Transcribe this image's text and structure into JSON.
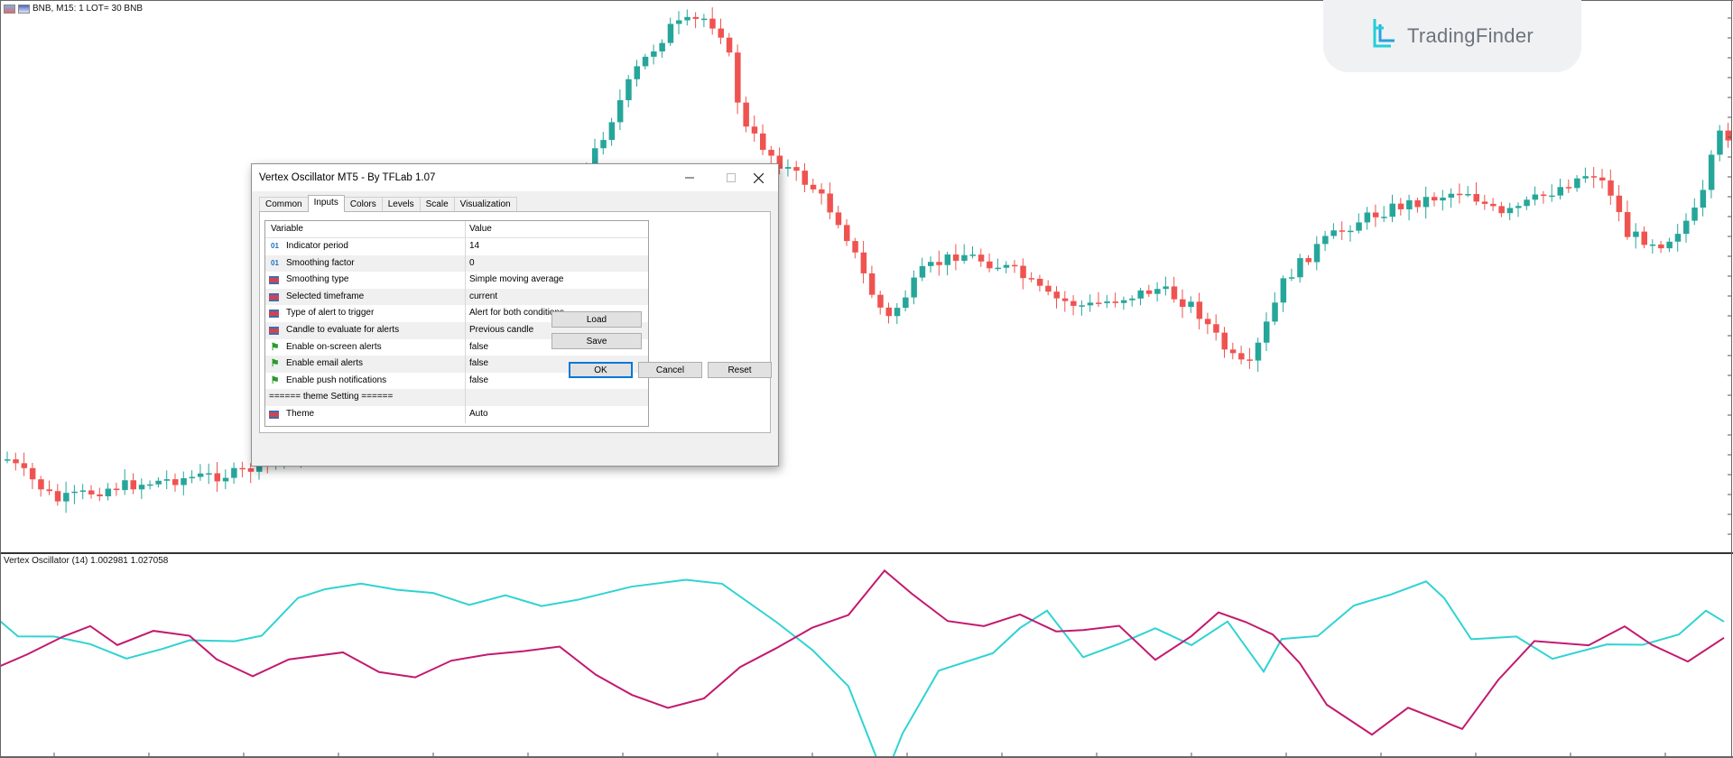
{
  "chart": {
    "symbol_label": "BNB, M15:  1 LOT= 30 BNB",
    "brand_text": "TradingFinder",
    "colors": {
      "bull": "#26a69a",
      "bear": "#ef5350",
      "line1": "#2fd3d3",
      "line2": "#c3196f"
    }
  },
  "oscillator": {
    "label": "Vertex Oscillator (14)  1.002981 1.027058"
  },
  "dialog": {
    "title": "Vertex Oscillator MT5 - By TFLab 1.07",
    "tabs": [
      "Common",
      "Inputs",
      "Colors",
      "Levels",
      "Scale",
      "Visualization"
    ],
    "active_tab": "Inputs",
    "columns": {
      "variable": "Variable",
      "value": "Value"
    },
    "rows": [
      {
        "icon": "numeric-icon",
        "icon_text": "01",
        "variable": "Indicator period",
        "value": "14"
      },
      {
        "icon": "numeric-icon",
        "icon_text": "01",
        "variable": "Smoothing factor",
        "value": "0"
      },
      {
        "icon": "list-icon",
        "icon_text": "",
        "variable": "Smoothing type",
        "value": "Simple moving average"
      },
      {
        "icon": "list-icon",
        "icon_text": "",
        "variable": "Selected timeframe",
        "value": "current"
      },
      {
        "icon": "list-icon",
        "icon_text": "",
        "variable": "Type of alert to trigger",
        "value": "Alert for both conditions"
      },
      {
        "icon": "list-icon",
        "icon_text": "",
        "variable": "Candle to evaluate for alerts",
        "value": "Previous candle"
      },
      {
        "icon": "bool-icon",
        "icon_text": "",
        "variable": "Enable on-screen alerts",
        "value": "false"
      },
      {
        "icon": "bool-icon",
        "icon_text": "",
        "variable": "Enable email alerts",
        "value": "false"
      },
      {
        "icon": "bool-icon",
        "icon_text": "",
        "variable": "Enable push notifications",
        "value": "false"
      },
      {
        "icon": "none",
        "icon_text": "",
        "variable": "====== theme Setting ======",
        "value": ""
      },
      {
        "icon": "list-icon",
        "icon_text": "",
        "variable": "Theme",
        "value": "Auto"
      }
    ],
    "buttons": {
      "load": "Load",
      "save": "Save",
      "ok": "OK",
      "cancel": "Cancel",
      "reset": "Reset"
    }
  }
}
